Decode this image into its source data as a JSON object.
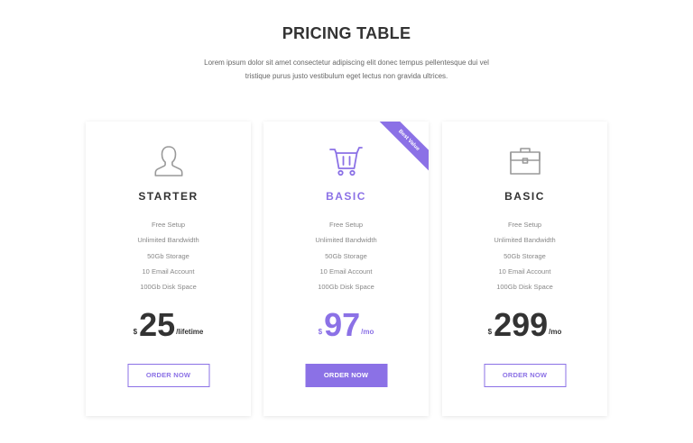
{
  "header": {
    "title": "PRICING TABLE",
    "subtitle": "Lorem ipsum dolor sit amet consectetur adipiscing elit donec tempus pellentesque dui vel tristique purus justo vestibulum eget lectus non gravida ultrices."
  },
  "colors": {
    "accent": "#8b71e6",
    "text": "#333333",
    "muted": "#888888"
  },
  "plans": [
    {
      "icon": "user-icon",
      "name": "STARTER",
      "features": [
        "Free Setup",
        "Unlimited Bandwidth",
        "50Gb Storage",
        "10 Email Account",
        "100Gb Disk Space"
      ],
      "currency": "$",
      "amount": "25",
      "period": "/lifetime",
      "button": "ORDER NOW"
    },
    {
      "icon": "shopping-cart-icon",
      "name": "BASIC",
      "ribbon": "Best Value",
      "features": [
        "Free Setup",
        "Unlimited Bandwidth",
        "50Gb Storage",
        "10 Email Account",
        "100Gb Disk Space"
      ],
      "currency": "$",
      "amount": "97",
      "period": "/mo",
      "button": "ORDER NOW"
    },
    {
      "icon": "briefcase-icon",
      "name": "BASIC",
      "features": [
        "Free Setup",
        "Unlimited Bandwidth",
        "50Gb Storage",
        "10 Email Account",
        "100Gb Disk Space"
      ],
      "currency": "$",
      "amount": "299",
      "period": "/mo",
      "button": "ORDER NOW"
    }
  ]
}
